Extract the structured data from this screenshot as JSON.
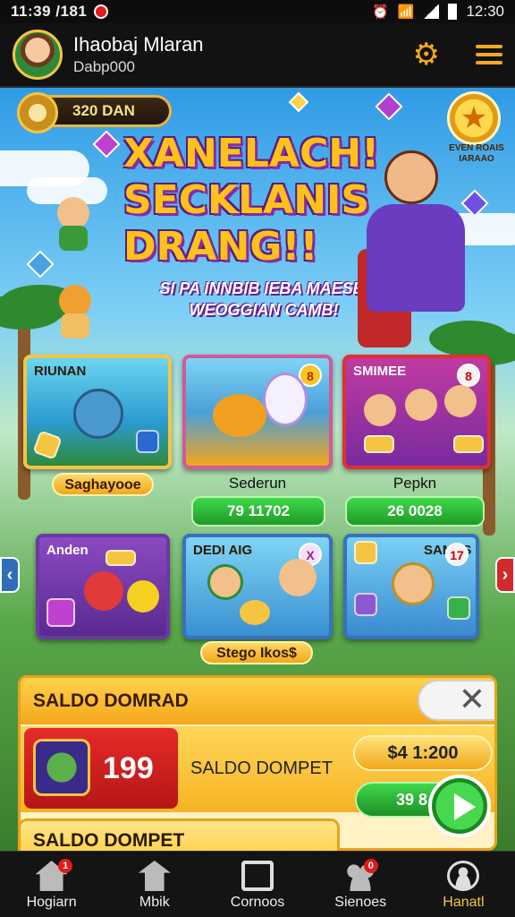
{
  "status_bar": {
    "time": "11:39 /181",
    "clock": "12:30"
  },
  "header": {
    "username": "Ihaobaj Mlaran",
    "subtitle": "Dabp000"
  },
  "coins": {
    "amount": "320 DAN"
  },
  "star_badge": {
    "text": "EVEN ROAIS IARAAO"
  },
  "banner": {
    "title_line1": "XANELACH!",
    "title_line2": "SECKLANIS",
    "title_line3": "DRANG!!",
    "subtitle": "SI PA INNBIB IEBA MAESEI WEOGGIAN CAMB!"
  },
  "games": [
    {
      "card_title": "RIUNAN",
      "badge": "",
      "caption": "Saghayooe",
      "button": ""
    },
    {
      "card_title": "",
      "badge": "8",
      "caption": "Sederun",
      "button": "79 11702"
    },
    {
      "card_title": "SMIMEE",
      "badge": "8",
      "caption": "Pepkn",
      "button": "26 0028"
    },
    {
      "card_title": "Anden",
      "badge": "",
      "caption": "",
      "button": ""
    },
    {
      "card_title": "DEDI AIG",
      "badge": "X",
      "caption": "Stego Ikos$",
      "button": ""
    },
    {
      "card_title": "SAMES",
      "badge": "17",
      "caption": "",
      "button": ""
    }
  ],
  "wallet": {
    "header": "SALDO DOMRAD",
    "count": "199",
    "label": "SALDO DOMPET",
    "amount": "$4 1:200",
    "amount2": "39 8",
    "footer_label": "SALDO DOMPET"
  },
  "nav": {
    "items": [
      {
        "label": "Hogiarn",
        "badge": "1"
      },
      {
        "label": "Mbik",
        "badge": ""
      },
      {
        "label": "Cornoos",
        "badge": ""
      },
      {
        "label": "Sienoes",
        "badge": "0"
      },
      {
        "label": "Hanatl",
        "badge": ""
      }
    ]
  },
  "colors": {
    "accent": "#f5c542",
    "nav_bg": "#141414",
    "play_green": "#1d8e24"
  }
}
